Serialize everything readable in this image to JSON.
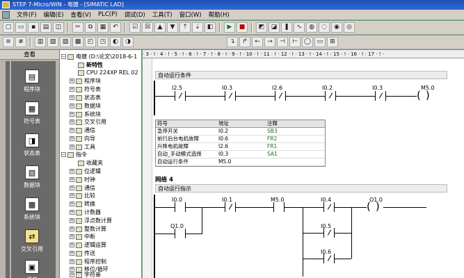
{
  "window": {
    "title": "STEP 7-Micro/WIN - 电镀 - [SIMATIC LAD]"
  },
  "menu": [
    "文件(F)",
    "编辑(E)",
    "查看(V)",
    "PLC(P)",
    "调试(D)",
    "工具(T)",
    "窗口(W)",
    "帮助(H)"
  ],
  "toolbar1": {
    "buttons": [
      "new",
      "open",
      "save",
      "print",
      "print-preview",
      "cut",
      "copy",
      "paste",
      "undo",
      "compile",
      "compile-all",
      "upload",
      "download",
      "sort-asc",
      "sort-desc",
      "options",
      "run",
      "stop",
      "program-status",
      "chart-status",
      "pause",
      "trend",
      "force",
      "unforce",
      "read",
      "write"
    ]
  },
  "toolbar2": {
    "buttons": [
      "network-insert",
      "network-delete",
      "symbol-table",
      "data-block",
      "cross-ref",
      "status-table",
      "seg-a",
      "seg-b",
      "sym",
      "addr"
    ]
  },
  "toolbar3": {
    "buttons": [
      "line-down",
      "line-up",
      "arrow-left",
      "arrow-right",
      "contact",
      "box",
      "coil",
      "box-fn",
      "box-plus"
    ]
  },
  "view": {
    "header": "查看",
    "items": [
      "程序块",
      "符号表",
      "状态表",
      "数据块",
      "系统块",
      "交叉引用",
      "通信"
    ]
  },
  "tree": {
    "items": [
      {
        "label": "电镀 (D:\\论文\\2018-6-1"
      },
      {
        "label": "新特性"
      },
      {
        "label": "CPU 224XP REL 02"
      },
      {
        "label": "程序块"
      },
      {
        "label": "符号表"
      },
      {
        "label": "状态表"
      },
      {
        "label": "数据块"
      },
      {
        "label": "系统块"
      },
      {
        "label": "交叉引用"
      },
      {
        "label": "通信"
      },
      {
        "label": "向导"
      },
      {
        "label": "工具"
      },
      {
        "label": "指令"
      },
      {
        "label": "收藏夹"
      },
      {
        "label": "位逻辑"
      },
      {
        "label": "时钟"
      },
      {
        "label": "通信"
      },
      {
        "label": "比较"
      },
      {
        "label": "转换"
      },
      {
        "label": "计数器"
      },
      {
        "label": "浮点数计算"
      },
      {
        "label": "整数计算"
      },
      {
        "label": "中断"
      },
      {
        "label": "逻辑运算"
      },
      {
        "label": "传送"
      },
      {
        "label": "程序控制"
      },
      {
        "label": "移位/循环"
      },
      {
        "label": "字符串"
      }
    ]
  },
  "ruler": "· 3 · ! · 4 · ! · 5 · ! · 6 · ! · 7 · ! · 8 · ! · 9 · ! · 10 · ! · 11 · ! · 12 · ! · 13 · ! · 14 · ! · 15 · ! · 16 · ! · 17 · ! ·",
  "net3": {
    "comment": "自动运行条件",
    "contacts": [
      "I2.5",
      "I0.3",
      "I2.6",
      "I0.2",
      "I0.3"
    ],
    "coil": "M5.0",
    "table": {
      "headers": [
        "符号",
        "地址",
        "注释"
      ],
      "rows": [
        [
          "急停开关",
          "I0.2",
          "SB3"
        ],
        [
          "前行后台电机故障",
          "I0.6",
          "FR2"
        ],
        [
          "升降电机故障",
          "I2.6",
          "FR1"
        ],
        [
          "自动_手动模式选择",
          "I0.3",
          "SA1"
        ],
        [
          "自动运行条件",
          "M5.0",
          ""
        ]
      ]
    }
  },
  "net4": {
    "label": "网络 4",
    "comment": "自动运行指示",
    "contacts": [
      "I0.0",
      "I0.1",
      "M5.0",
      "I0.4",
      "Q1.0",
      "I0.5",
      "I0.6"
    ],
    "coil": "Q1.0"
  }
}
